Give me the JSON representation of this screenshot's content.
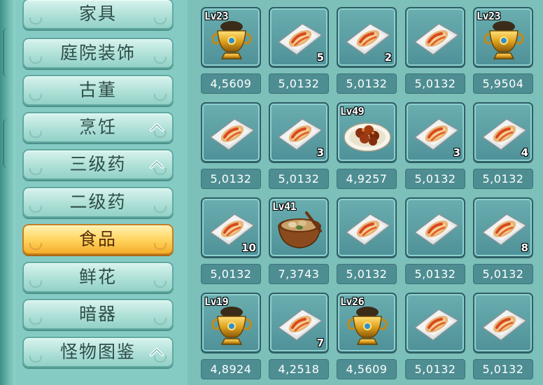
{
  "categories": [
    {
      "label": "家具",
      "expanded": false,
      "selected": false
    },
    {
      "label": "庭院装饰",
      "expanded": false,
      "selected": false
    },
    {
      "label": "古董",
      "expanded": false,
      "selected": false
    },
    {
      "label": "烹饪",
      "expanded": true,
      "selected": false
    },
    {
      "label": "三级药",
      "expanded": true,
      "selected": false
    },
    {
      "label": "二级药",
      "expanded": false,
      "selected": false
    },
    {
      "label": "食品",
      "expanded": false,
      "selected": true
    },
    {
      "label": "鲜花",
      "expanded": false,
      "selected": false
    },
    {
      "label": "暗器",
      "expanded": false,
      "selected": false
    },
    {
      "label": "怪物图鉴",
      "expanded": true,
      "selected": false
    }
  ],
  "items": [
    {
      "icon": "golden-urn",
      "level": "Lv23",
      "quantity": "",
      "price": "4,5609"
    },
    {
      "icon": "food-plate",
      "level": "",
      "quantity": "5",
      "price": "5,0132"
    },
    {
      "icon": "food-plate",
      "level": "",
      "quantity": "2",
      "price": "5,0132"
    },
    {
      "icon": "food-plate",
      "level": "",
      "quantity": "",
      "price": "5,0132"
    },
    {
      "icon": "golden-urn",
      "level": "Lv23",
      "quantity": "",
      "price": "5,9504"
    },
    {
      "icon": "food-plate",
      "level": "",
      "quantity": "",
      "price": "5,0132"
    },
    {
      "icon": "food-plate",
      "level": "",
      "quantity": "3",
      "price": "5,0132"
    },
    {
      "icon": "meat-dish",
      "level": "Lv49",
      "quantity": "",
      "price": "4,9257"
    },
    {
      "icon": "food-plate",
      "level": "",
      "quantity": "3",
      "price": "5,0132"
    },
    {
      "icon": "food-plate",
      "level": "",
      "quantity": "4",
      "price": "5,0132"
    },
    {
      "icon": "food-plate",
      "level": "",
      "quantity": "10",
      "price": "5,0132"
    },
    {
      "icon": "stew-bowl",
      "level": "Lv41",
      "quantity": "",
      "price": "7,3743"
    },
    {
      "icon": "food-plate",
      "level": "",
      "quantity": "",
      "price": "5,0132"
    },
    {
      "icon": "food-plate",
      "level": "",
      "quantity": "",
      "price": "5,0132"
    },
    {
      "icon": "food-plate",
      "level": "",
      "quantity": "8",
      "price": "5,0132"
    },
    {
      "icon": "golden-urn",
      "level": "Lv19",
      "quantity": "",
      "price": "4,8924"
    },
    {
      "icon": "food-plate",
      "level": "",
      "quantity": "7",
      "price": "4,2518"
    },
    {
      "icon": "golden-urn",
      "level": "Lv26",
      "quantity": "",
      "price": "4,5609"
    },
    {
      "icon": "food-plate",
      "level": "",
      "quantity": "",
      "price": "5,0132"
    },
    {
      "icon": "food-plate",
      "level": "",
      "quantity": "",
      "price": "5,0132"
    }
  ],
  "colors": {
    "panel": "#86cbc3",
    "selected_category": "#ffd25a",
    "slot": "#4f9198",
    "price_bg": "#4e8e92"
  }
}
